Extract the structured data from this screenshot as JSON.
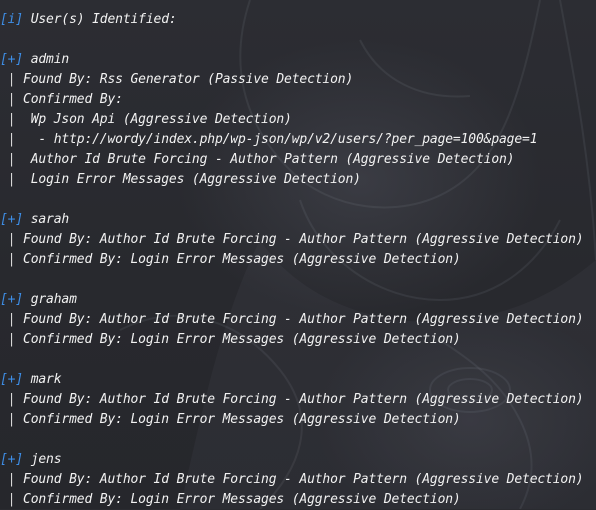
{
  "terminal": {
    "header": {
      "tag": "[i]",
      "text": " User(s) Identified:"
    },
    "users": [
      {
        "tag": "[+]",
        "name": " admin",
        "details": [
          " Found By: Rss Generator (Passive Detection)",
          " Confirmed By:",
          "  Wp Json Api (Aggressive Detection)",
          "   - http://wordy/index.php/wp-json/wp/v2/users/?per_page=100&page=1",
          "  Author Id Brute Forcing - Author Pattern (Aggressive Detection)",
          "  Login Error Messages (Aggressive Detection)"
        ]
      },
      {
        "tag": "[+]",
        "name": " sarah",
        "details": [
          " Found By: Author Id Brute Forcing - Author Pattern (Aggressive Detection)",
          " Confirmed By: Login Error Messages (Aggressive Detection)"
        ]
      },
      {
        "tag": "[+]",
        "name": " graham",
        "details": [
          " Found By: Author Id Brute Forcing - Author Pattern (Aggressive Detection)",
          " Confirmed By: Login Error Messages (Aggressive Detection)"
        ]
      },
      {
        "tag": "[+]",
        "name": " mark",
        "details": [
          " Found By: Author Id Brute Forcing - Author Pattern (Aggressive Detection)",
          " Confirmed By: Login Error Messages (Aggressive Detection)"
        ]
      },
      {
        "tag": "[+]",
        "name": " jens",
        "details": [
          " Found By: Author Id Brute Forcing - Author Pattern (Aggressive Detection)",
          " Confirmed By: Login Error Messages (Aggressive Detection)"
        ]
      }
    ],
    "detail_prefix": " |",
    "colors": {
      "tag": "#3e8ee6",
      "text": "#f2f2f2",
      "background": "#2a2b30"
    }
  }
}
